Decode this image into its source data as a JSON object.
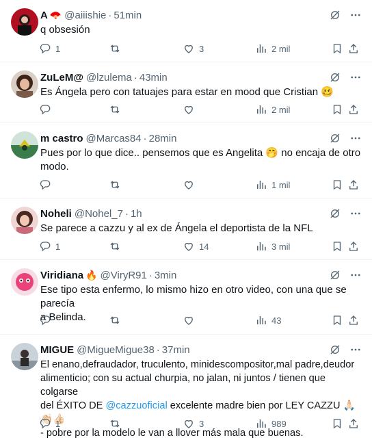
{
  "tweets": [
    {
      "name": "A",
      "emoji": "🪭",
      "handle": "@aiiishie",
      "time": "51min",
      "lines": [
        "q obsesión"
      ],
      "replies": "1",
      "retweets": "",
      "likes": "3",
      "views": "2 mil"
    },
    {
      "name": "ZuLeM@",
      "emoji": "",
      "handle": "@lzulema",
      "time": "43min",
      "lines": [
        "Es Ángela pero con tatuajes para estar en mood que Cristian 🥴"
      ],
      "replies": "",
      "retweets": "",
      "likes": "",
      "views": "2 mil"
    },
    {
      "name": "m castro",
      "emoji": "",
      "handle": "@Marcas84",
      "time": "28min",
      "lines": [
        "Pues por lo que dice.. pensemos que es Angelita 🤭 no encaja de otro",
        "modo."
      ],
      "replies": "",
      "retweets": "",
      "likes": "",
      "views": "1 mil"
    },
    {
      "name": "Noheli",
      "emoji": "",
      "handle": "@Nohel_7",
      "time": "1h",
      "lines": [
        "Se parece a cazzu y al ex de Ángela el deportista de la NFL"
      ],
      "replies": "1",
      "retweets": "",
      "likes": "14",
      "views": "3 mil"
    },
    {
      "name": "Viridiana",
      "emoji": "🔥",
      "handle": "@ViryR91",
      "time": "3min",
      "lines": [
        "Ese tipo esta enfermo, lo mismo hizo en otro video, con una que se parecía",
        "a Belinda."
      ],
      "replies": "",
      "retweets": "",
      "likes": "",
      "views": "43"
    },
    {
      "name": "MIGUE",
      "emoji": "",
      "handle": "@MigueMigue38",
      "time": "37min",
      "lines": [
        "El enano,defraudador, truculento, minidescompositor,mal padre,deudor",
        "alimenticio; con su actual churpia, no jalan, ni juntos / tienen que colgarse",
        "del ÉXITO DE ",
        "- pobre por la modelo le van a llover más mala que buenas."
      ],
      "mention": "@cazzuoficial",
      "line3_rest": " excelente madre bien por LEY CAZZU 🙏🏻👏🏻👍🏻",
      "replies": "1",
      "retweets": "",
      "likes": "3",
      "views": "989"
    }
  ],
  "colors": {
    "text": "#0f1419",
    "muted": "#536471",
    "link": "#1d9bf0",
    "divider": "#eff3f4"
  },
  "icons": [
    "grok-icon",
    "more-icon",
    "reply-icon",
    "retweet-icon",
    "like-icon",
    "views-icon",
    "bookmark-icon",
    "share-icon"
  ]
}
